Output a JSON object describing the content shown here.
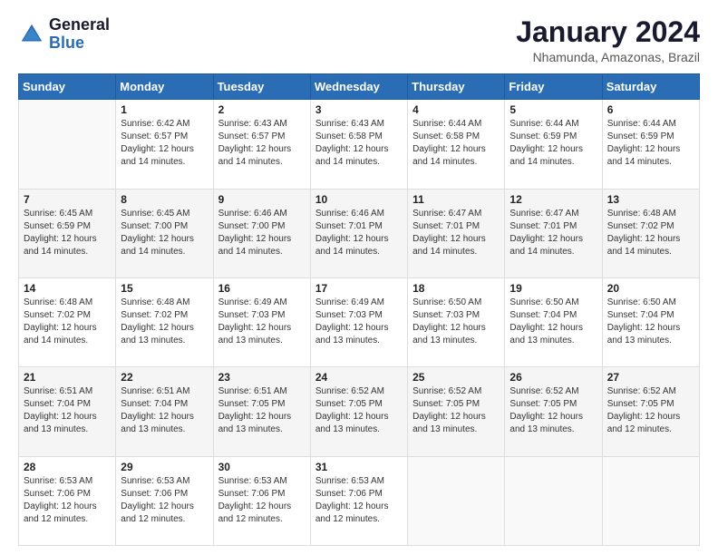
{
  "header": {
    "logo_line1": "General",
    "logo_line2": "Blue",
    "title": "January 2024",
    "subtitle": "Nhamunda, Amazonas, Brazil"
  },
  "days_of_week": [
    "Sunday",
    "Monday",
    "Tuesday",
    "Wednesday",
    "Thursday",
    "Friday",
    "Saturday"
  ],
  "weeks": [
    [
      {
        "day": "",
        "info": ""
      },
      {
        "day": "1",
        "info": "Sunrise: 6:42 AM\nSunset: 6:57 PM\nDaylight: 12 hours\nand 14 minutes."
      },
      {
        "day": "2",
        "info": "Sunrise: 6:43 AM\nSunset: 6:57 PM\nDaylight: 12 hours\nand 14 minutes."
      },
      {
        "day": "3",
        "info": "Sunrise: 6:43 AM\nSunset: 6:58 PM\nDaylight: 12 hours\nand 14 minutes."
      },
      {
        "day": "4",
        "info": "Sunrise: 6:44 AM\nSunset: 6:58 PM\nDaylight: 12 hours\nand 14 minutes."
      },
      {
        "day": "5",
        "info": "Sunrise: 6:44 AM\nSunset: 6:59 PM\nDaylight: 12 hours\nand 14 minutes."
      },
      {
        "day": "6",
        "info": "Sunrise: 6:44 AM\nSunset: 6:59 PM\nDaylight: 12 hours\nand 14 minutes."
      }
    ],
    [
      {
        "day": "7",
        "info": ""
      },
      {
        "day": "8",
        "info": "Sunrise: 6:45 AM\nSunset: 7:00 PM\nDaylight: 12 hours\nand 14 minutes."
      },
      {
        "day": "9",
        "info": "Sunrise: 6:46 AM\nSunset: 7:00 PM\nDaylight: 12 hours\nand 14 minutes."
      },
      {
        "day": "10",
        "info": "Sunrise: 6:46 AM\nSunset: 7:01 PM\nDaylight: 12 hours\nand 14 minutes."
      },
      {
        "day": "11",
        "info": "Sunrise: 6:47 AM\nSunset: 7:01 PM\nDaylight: 12 hours\nand 14 minutes."
      },
      {
        "day": "12",
        "info": "Sunrise: 6:47 AM\nSunset: 7:01 PM\nDaylight: 12 hours\nand 14 minutes."
      },
      {
        "day": "13",
        "info": "Sunrise: 6:48 AM\nSunset: 7:02 PM\nDaylight: 12 hours\nand 14 minutes."
      }
    ],
    [
      {
        "day": "14",
        "info": ""
      },
      {
        "day": "15",
        "info": "Sunrise: 6:48 AM\nSunset: 7:02 PM\nDaylight: 12 hours\nand 13 minutes."
      },
      {
        "day": "16",
        "info": "Sunrise: 6:49 AM\nSunset: 7:03 PM\nDaylight: 12 hours\nand 13 minutes."
      },
      {
        "day": "17",
        "info": "Sunrise: 6:49 AM\nSunset: 7:03 PM\nDaylight: 12 hours\nand 13 minutes."
      },
      {
        "day": "18",
        "info": "Sunrise: 6:50 AM\nSunset: 7:03 PM\nDaylight: 12 hours\nand 13 minutes."
      },
      {
        "day": "19",
        "info": "Sunrise: 6:50 AM\nSunset: 7:04 PM\nDaylight: 12 hours\nand 13 minutes."
      },
      {
        "day": "20",
        "info": "Sunrise: 6:50 AM\nSunset: 7:04 PM\nDaylight: 12 hours\nand 13 minutes."
      }
    ],
    [
      {
        "day": "21",
        "info": ""
      },
      {
        "day": "22",
        "info": "Sunrise: 6:51 AM\nSunset: 7:04 PM\nDaylight: 12 hours\nand 13 minutes."
      },
      {
        "day": "23",
        "info": "Sunrise: 6:51 AM\nSunset: 7:05 PM\nDaylight: 12 hours\nand 13 minutes."
      },
      {
        "day": "24",
        "info": "Sunrise: 6:52 AM\nSunset: 7:05 PM\nDaylight: 12 hours\nand 13 minutes."
      },
      {
        "day": "25",
        "info": "Sunrise: 6:52 AM\nSunset: 7:05 PM\nDaylight: 12 hours\nand 13 minutes."
      },
      {
        "day": "26",
        "info": "Sunrise: 6:52 AM\nSunset: 7:05 PM\nDaylight: 12 hours\nand 13 minutes."
      },
      {
        "day": "27",
        "info": "Sunrise: 6:52 AM\nSunset: 7:05 PM\nDaylight: 12 hours\nand 12 minutes."
      }
    ],
    [
      {
        "day": "28",
        "info": "Sunrise: 6:53 AM\nSunset: 7:06 PM\nDaylight: 12 hours\nand 12 minutes."
      },
      {
        "day": "29",
        "info": "Sunrise: 6:53 AM\nSunset: 7:06 PM\nDaylight: 12 hours\nand 12 minutes."
      },
      {
        "day": "30",
        "info": "Sunrise: 6:53 AM\nSunset: 7:06 PM\nDaylight: 12 hours\nand 12 minutes."
      },
      {
        "day": "31",
        "info": "Sunrise: 6:53 AM\nSunset: 7:06 PM\nDaylight: 12 hours\nand 12 minutes."
      },
      {
        "day": "",
        "info": ""
      },
      {
        "day": "",
        "info": ""
      },
      {
        "day": "",
        "info": ""
      }
    ]
  ],
  "week1_day7_info": "Sunrise: 6:45 AM\nSunset: 6:59 PM\nDaylight: 12 hours\nand 14 minutes.",
  "week3_day14_info": "Sunrise: 6:48 AM\nSunset: 7:02 PM\nDaylight: 12 hours\nand 14 minutes.",
  "week4_day21_info": "Sunrise: 6:51 AM\nSunset: 7:04 PM\nDaylight: 12 hours\nand 13 minutes."
}
